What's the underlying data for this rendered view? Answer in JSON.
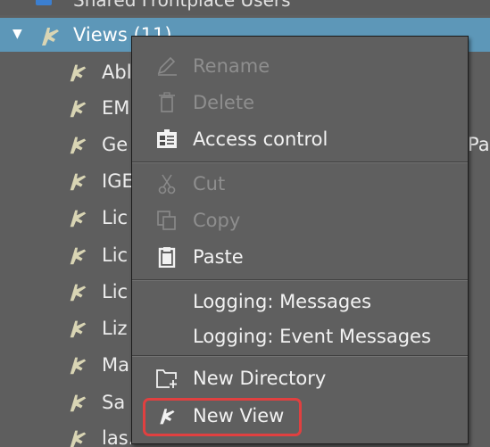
{
  "tree": {
    "top_partial_label": "Shared Frontplace Users",
    "views_node": {
      "label": "Views (11)",
      "expanded": true
    },
    "children": [
      {
        "label": "Abl"
      },
      {
        "label": "EM"
      },
      {
        "label": "Ge"
      },
      {
        "label": "IGE"
      },
      {
        "label": "Lic"
      },
      {
        "label": "Lic"
      },
      {
        "label": "Lic"
      },
      {
        "label": "Liz"
      },
      {
        "label": "Ma"
      },
      {
        "label": "Sa"
      },
      {
        "label": "las..."
      }
    ],
    "right_fragment": "Pa"
  },
  "context_menu": {
    "items": [
      {
        "label": "Rename",
        "icon": "pencil-icon",
        "enabled": false
      },
      {
        "label": "Delete",
        "icon": "trash-icon",
        "enabled": false
      },
      {
        "label": "Access control",
        "icon": "access-control-icon",
        "enabled": true
      },
      {
        "label": "Cut",
        "icon": "scissors-icon",
        "enabled": false
      },
      {
        "label": "Copy",
        "icon": "copy-icon",
        "enabled": false
      },
      {
        "label": "Paste",
        "icon": "clipboard-icon",
        "enabled": true
      },
      {
        "label": "Logging: Messages",
        "icon": "",
        "enabled": true
      },
      {
        "label": "Logging: Event Messages",
        "icon": "",
        "enabled": true
      },
      {
        "label": "New Directory",
        "icon": "new-directory-icon",
        "enabled": true
      },
      {
        "label": "New View",
        "icon": "view-icon",
        "enabled": true,
        "highlighted": true
      }
    ],
    "highlight_color": "#e04040"
  },
  "colors": {
    "selection": "#5d97b8",
    "background": "#5e5e5e",
    "menu_bg": "#5f5f5f"
  }
}
